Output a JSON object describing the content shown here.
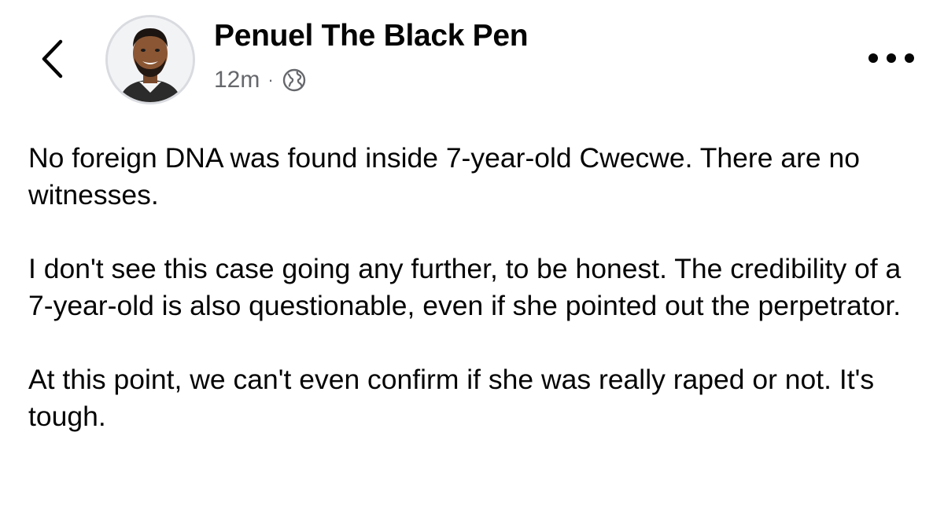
{
  "header": {
    "back_icon": "chevron-left-icon",
    "author_name": "Penuel The Black Pen",
    "timestamp": "12m",
    "separator": "·",
    "audience_icon": "globe-icon",
    "more_icon": "more-horizontal-icon"
  },
  "post": {
    "paragraphs": [
      "No foreign DNA was found inside 7-year-old Cwecwe. There are no witnesses.",
      "I don't see this case going any further, to be honest. The credibility of a 7-year-old is also questionable, even if she pointed out the perpetrator.",
      "At this point, we can't even confirm if she was really raped or not. It's tough."
    ]
  },
  "colors": {
    "text": "#050505",
    "meta_text": "#65676b",
    "avatar_border": "#d9dbe0",
    "background": "#ffffff"
  }
}
